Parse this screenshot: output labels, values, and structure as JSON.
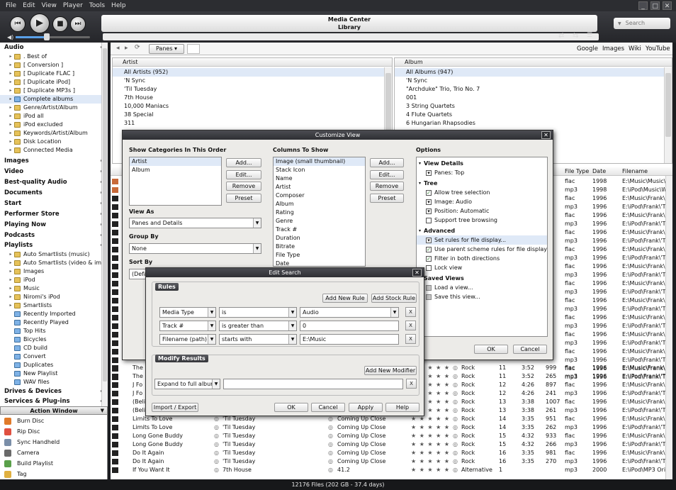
{
  "menu": [
    "File",
    "Edit",
    "View",
    "Player",
    "Tools",
    "Help"
  ],
  "window_controls": [
    "_",
    "□",
    "✕"
  ],
  "player": {
    "title": "Media Center",
    "subtitle": "Library",
    "search_placeholder": "Search"
  },
  "toolbar": {
    "panes_label": "Panes ▾",
    "links": [
      "Google",
      "Images",
      "Wiki",
      "YouTube"
    ]
  },
  "sidebar": {
    "audio_header": "Audio",
    "audio_items": [
      {
        "label": ". Best of",
        "icon": "fold"
      },
      {
        "label": "[ Conversion ]",
        "icon": "fold"
      },
      {
        "label": "[ Duplicate FLAC ]",
        "icon": "fold"
      },
      {
        "label": "[ Duplicate iPod]",
        "icon": "fold"
      },
      {
        "label": "[ Duplicate MP3s ]",
        "icon": "fold"
      },
      {
        "label": "Complete albums",
        "icon": "smart",
        "selected": true
      },
      {
        "label": "Genre/Artist/Album",
        "icon": "fold"
      },
      {
        "label": "iPod all",
        "icon": "fold"
      },
      {
        "label": "iPod excluded",
        "icon": "fold"
      },
      {
        "label": "Keywords/Artist/Album",
        "icon": "fold"
      },
      {
        "label": "Disk Location",
        "icon": "fold"
      },
      {
        "label": "Connected Media",
        "icon": "fold"
      }
    ],
    "sections": [
      "Images",
      "Video",
      "Best-quality Audio",
      "Documents",
      "Start",
      "Performer Store",
      "Playing Now",
      "Podcasts"
    ],
    "playlists_header": "Playlists",
    "playlist_items": [
      {
        "label": "Auto Smartlists (music)",
        "icon": "fold",
        "tri": true
      },
      {
        "label": "Auto Smartlists (video & im...",
        "icon": "fold",
        "tri": true
      },
      {
        "label": "Images",
        "icon": "fold",
        "tri": true
      },
      {
        "label": "iPod",
        "icon": "fold",
        "tri": true
      },
      {
        "label": "Music",
        "icon": "fold",
        "tri": true
      },
      {
        "label": "Niromi's iPod",
        "icon": "fold",
        "tri": true
      },
      {
        "label": "Smartlists",
        "icon": "fold",
        "tri": true
      },
      {
        "label": "Recently Imported",
        "icon": "smart",
        "tri": false
      },
      {
        "label": "Recently Played",
        "icon": "smart",
        "tri": false
      },
      {
        "label": "Top Hits",
        "icon": "smart",
        "tri": false
      },
      {
        "label": "Bicycles",
        "icon": "smart",
        "tri": false
      },
      {
        "label": "CD build",
        "icon": "smart",
        "tri": false
      },
      {
        "label": "Convert",
        "icon": "smart",
        "tri": false
      },
      {
        "label": "Duplicates",
        "icon": "smart",
        "tri": false
      },
      {
        "label": "New Playlist",
        "icon": "smart",
        "tri": false
      },
      {
        "label": "WAV files",
        "icon": "smart",
        "tri": false
      }
    ],
    "bottom_sections": [
      "Drives & Devices",
      "Services & Plug-ins"
    ],
    "action_window": "Action Window",
    "actions": [
      {
        "label": "Burn Disc",
        "color": "#e07a2a"
      },
      {
        "label": "Rip Disc",
        "color": "#e05040"
      },
      {
        "label": "Sync Handheld",
        "color": "#7a8ea8"
      },
      {
        "label": "Camera",
        "color": "#6a6a6a"
      },
      {
        "label": "Build Playlist",
        "color": "#5aa04a"
      },
      {
        "label": "Tag",
        "color": "#e0b040"
      }
    ]
  },
  "artist_pane": {
    "header": "Artist",
    "items": [
      "All Artists (952)",
      "'N Sync",
      "'Til Tuesday",
      "7th House",
      "10,000 Maniacs",
      "38 Special",
      "311"
    ]
  },
  "album_pane": {
    "header": "Album",
    "items": [
      "All Albums (947)",
      "'N Sync",
      "\"Archduke\" Trio, Trio No. 7",
      "001",
      "3 String Quartets",
      "4 Flute Quartets",
      "6 Hungarian Rhapsodies"
    ]
  },
  "grid": {
    "headers": {
      "file_type": "File Type",
      "date": "Date",
      "filename": "Filename"
    },
    "top_rows": [
      {
        "ft": "flac",
        "date": "1998",
        "fn": "E:\\Music\\Music\\Wa"
      },
      {
        "ft": "mp3",
        "date": "1998",
        "fn": "E:\\iPod\\Music\\Wa"
      },
      {
        "ft": "flac",
        "date": "1996",
        "fn": "E:\\Music\\Frank\\'Til"
      },
      {
        "ft": "mp3",
        "date": "1996",
        "fn": "E:\\iPod\\Frank\\'Til"
      },
      {
        "ft": "flac",
        "date": "1996",
        "fn": "E:\\Music\\Frank\\'Til"
      },
      {
        "ft": "mp3",
        "date": "1996",
        "fn": "E:\\iPod\\Frank\\'Til"
      },
      {
        "ft": "flac",
        "date": "1996",
        "fn": "E:\\Music\\Frank\\'Til"
      },
      {
        "ft": "mp3",
        "date": "1996",
        "fn": "E:\\iPod\\Frank\\'Til"
      },
      {
        "ft": "flac",
        "date": "1996",
        "fn": "E:\\Music\\Frank\\'Til"
      },
      {
        "ft": "mp3",
        "date": "1996",
        "fn": "E:\\iPod\\Frank\\'Til"
      },
      {
        "ft": "flac",
        "date": "1996",
        "fn": "E:\\Music\\Frank\\'Til"
      },
      {
        "ft": "mp3",
        "date": "1996",
        "fn": "E:\\iPod\\Frank\\'Til"
      },
      {
        "ft": "flac",
        "date": "1996",
        "fn": "E:\\Music\\Frank\\'Til"
      },
      {
        "ft": "mp3",
        "date": "1996",
        "fn": "E:\\iPod\\Frank\\'Til"
      },
      {
        "ft": "flac",
        "date": "1996",
        "fn": "E:\\Music\\Frank\\'Til"
      },
      {
        "ft": "mp3",
        "date": "1996",
        "fn": "E:\\iPod\\Frank\\'Til"
      },
      {
        "ft": "flac",
        "date": "1996",
        "fn": "E:\\Music\\Frank\\'Til"
      },
      {
        "ft": "mp3",
        "date": "1996",
        "fn": "E:\\iPod\\Frank\\'Til"
      },
      {
        "ft": "flac",
        "date": "1996",
        "fn": "E:\\Music\\Frank\\'Til"
      },
      {
        "ft": "mp3",
        "date": "1996",
        "fn": "E:\\iPod\\Frank\\'Til"
      },
      {
        "ft": "flac",
        "date": "1996",
        "fn": "E:\\Music\\Frank\\'Til"
      },
      {
        "ft": "mp3",
        "date": "1996",
        "fn": "E:\\iPod\\Frank\\'Til"
      },
      {
        "ft": "flac",
        "date": "1996",
        "fn": "E:\\Music\\Frank\\'Til"
      },
      {
        "ft": "mp3",
        "date": "1996",
        "fn": "E:\\iPod\\Frank\\'Til"
      }
    ],
    "rows": [
      {
        "name": "The",
        "artist": "",
        "album": "",
        "genre": "Rock",
        "track": "11",
        "dur": "3:52",
        "br": "999",
        "ft": "flac",
        "date": "1996",
        "fn": "E:\\Music\\Frank\\'Til"
      },
      {
        "name": "The",
        "artist": "",
        "album": "",
        "genre": "Rock",
        "track": "11",
        "dur": "3:52",
        "br": "265",
        "ft": "mp3",
        "date": "1996",
        "fn": "E:\\iPod\\Frank\\'Til"
      },
      {
        "name": "J Fo",
        "artist": "",
        "album": "",
        "genre": "Rock",
        "track": "12",
        "dur": "4:26",
        "br": "897",
        "ft": "flac",
        "date": "1996",
        "fn": "E:\\Music\\Frank\\'Til"
      },
      {
        "name": "J Fo",
        "artist": "",
        "album": "",
        "genre": "Rock",
        "track": "12",
        "dur": "4:26",
        "br": "241",
        "ft": "mp3",
        "date": "1996",
        "fn": "E:\\iPod\\Frank\\'Til"
      },
      {
        "name": "(Beli",
        "artist": "",
        "album": "",
        "genre": "Rock",
        "track": "13",
        "dur": "3:38",
        "br": "1007",
        "ft": "flac",
        "date": "1996",
        "fn": "E:\\Music\\Frank\\'Til"
      },
      {
        "name": "(Beli",
        "artist": "",
        "album": "",
        "genre": "Rock",
        "track": "13",
        "dur": "3:38",
        "br": "261",
        "ft": "mp3",
        "date": "1996",
        "fn": "E:\\iPod\\Frank\\'Til"
      },
      {
        "name": "Limits To Love",
        "artist": "'Til Tuesday",
        "album": "Coming Up Close",
        "genre": "Rock",
        "track": "14",
        "dur": "3:35",
        "br": "951",
        "ft": "flac",
        "date": "1996",
        "fn": "E:\\Music\\Frank\\'Til"
      },
      {
        "name": "Limits To Love",
        "artist": "'Til Tuesday",
        "album": "Coming Up Close",
        "genre": "Rock",
        "track": "14",
        "dur": "3:35",
        "br": "262",
        "ft": "mp3",
        "date": "1996",
        "fn": "E:\\iPod\\Frank\\'Til"
      },
      {
        "name": "Long Gone Buddy",
        "artist": "'Til Tuesday",
        "album": "Coming Up Close",
        "genre": "Rock",
        "track": "15",
        "dur": "4:32",
        "br": "933",
        "ft": "flac",
        "date": "1996",
        "fn": "E:\\Music\\Frank\\'Til"
      },
      {
        "name": "Long Gone Buddy",
        "artist": "'Til Tuesday",
        "album": "Coming Up Close",
        "genre": "Rock",
        "track": "15",
        "dur": "4:32",
        "br": "266",
        "ft": "mp3",
        "date": "1996",
        "fn": "E:\\iPod\\Frank\\'Til"
      },
      {
        "name": "Do It Again",
        "artist": "'Til Tuesday",
        "album": "Coming Up Close",
        "genre": "Rock",
        "track": "16",
        "dur": "3:35",
        "br": "981",
        "ft": "flac",
        "date": "1996",
        "fn": "E:\\Music\\Frank\\'Til"
      },
      {
        "name": "Do It Again",
        "artist": "'Til Tuesday",
        "album": "Coming Up Close",
        "genre": "Rock",
        "track": "16",
        "dur": "3:35",
        "br": "270",
        "ft": "mp3",
        "date": "1996",
        "fn": "E:\\iPod\\Frank\\'Til"
      },
      {
        "name": "If You Want It",
        "artist": "7th House",
        "album": "41.2",
        "genre": "Alternative",
        "track": "1",
        "dur": "",
        "br": "",
        "ft": "mp3",
        "date": "2000",
        "fn": "E:\\iPod\\MP3 Ori"
      }
    ]
  },
  "customize": {
    "title": "Customize View",
    "categories_label": "Show Categories In This Order",
    "categories": [
      "Artist",
      "Album"
    ],
    "cat_buttons": [
      "Add...",
      "Edit...",
      "Remove",
      "Preset"
    ],
    "view_as_label": "View As",
    "view_as_value": "Panes and Details",
    "group_by_label": "Group By",
    "group_by_value": "None",
    "sort_by_label": "Sort By",
    "sort_by_value": "(Defa",
    "columns_label": "Columns To Show",
    "columns": [
      "Image (small thumbnail)",
      "Stack Icon",
      "Name",
      "Artist",
      "Composer",
      "Album",
      "Rating",
      "Genre",
      "Track #",
      "Duration",
      "Bitrate",
      "File Type",
      "Date"
    ],
    "col_buttons": [
      "Add...",
      "Edit...",
      "Remove",
      "Preset"
    ],
    "options_label": "Options",
    "view_details_header": "View Details",
    "panes_opt": "Panes: Top",
    "tree_header": "Tree",
    "tree_opts": [
      {
        "label": "Allow tree selection",
        "checked": true
      },
      {
        "label": "Image: Audio",
        "checked": false,
        "drop": true
      },
      {
        "label": "Position: Automatic",
        "checked": false,
        "drop": true
      },
      {
        "label": "Support tree browsing",
        "checked": false
      }
    ],
    "advanced_header": "Advanced",
    "advanced_opts": [
      {
        "label": "Set rules for file display...",
        "checked": false,
        "drop": true,
        "selected": true
      },
      {
        "label": "Use parent scheme rules for file display",
        "checked": true
      },
      {
        "label": "Filter in both directions",
        "checked": true
      },
      {
        "label": "Lock view",
        "checked": false
      }
    ],
    "saved_header": "Saved Views",
    "saved_opts": [
      "Load a view...",
      "Save this view..."
    ],
    "ok": "OK",
    "cancel": "Cancel"
  },
  "edit_search": {
    "title": "Edit Search",
    "rules_label": "Rules",
    "add_new_rule": "Add New Rule",
    "add_stock_rule": "Add Stock Rule",
    "rules": [
      {
        "field": "Media Type",
        "op": "is",
        "value": "Audio"
      },
      {
        "field": "Track #",
        "op": "is greater than",
        "value": "0"
      },
      {
        "field": "Filename (path)",
        "op": "starts with",
        "value": "E:\\Music"
      }
    ],
    "modify_label": "Modify Results",
    "add_new_modifier": "Add New Modifier",
    "modifier": "Expand to full albums",
    "x": "X",
    "import_export": "Import / Export",
    "ok": "OK",
    "cancel": "Cancel",
    "apply": "Apply",
    "help": "Help"
  },
  "status": "12176 Files (202 GB - 37.4 days)"
}
